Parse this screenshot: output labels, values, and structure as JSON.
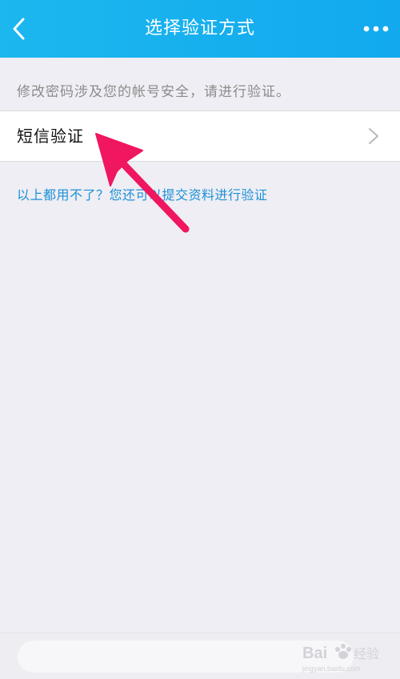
{
  "header": {
    "title": "选择验证方式",
    "back_icon": "chevron-left-icon",
    "more_icon": "more-dots-icon",
    "background_color": "#1aaef0"
  },
  "main": {
    "hint": "修改密码涉及您的帐号安全，请进行验证。",
    "options": [
      {
        "label": "短信验证",
        "icon": "chevron-right-icon"
      }
    ],
    "alternative_link": "以上都用不了？您还可以提交资料进行验证"
  },
  "annotation": {
    "arrow_color": "#f0165f"
  },
  "watermark": {
    "text": "Bai 经验",
    "subtext": "jingyan.baidu.com"
  }
}
